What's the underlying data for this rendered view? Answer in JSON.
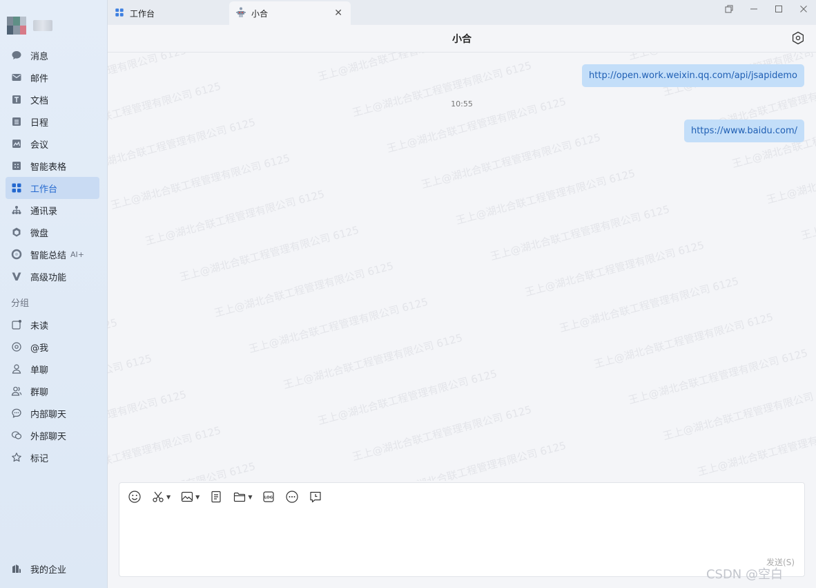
{
  "sidebar": {
    "items": [
      {
        "label": "消息",
        "icon": "message-icon"
      },
      {
        "label": "邮件",
        "icon": "mail-icon"
      },
      {
        "label": "文档",
        "icon": "doc-icon"
      },
      {
        "label": "日程",
        "icon": "calendar-icon"
      },
      {
        "label": "会议",
        "icon": "meeting-icon"
      },
      {
        "label": "智能表格",
        "icon": "smart-table-icon"
      },
      {
        "label": "工作台",
        "icon": "workbench-icon",
        "active": true
      },
      {
        "label": "通讯录",
        "icon": "contacts-icon"
      },
      {
        "label": "微盘",
        "icon": "drive-icon"
      },
      {
        "label": "智能总结",
        "icon": "summary-icon",
        "badge": "AI+"
      },
      {
        "label": "高级功能",
        "icon": "advanced-icon"
      }
    ],
    "group_label": "分组",
    "groups": [
      {
        "label": "未读",
        "icon": "unread-icon"
      },
      {
        "label": "@我",
        "icon": "at-icon"
      },
      {
        "label": "单聊",
        "icon": "single-chat-icon"
      },
      {
        "label": "群聊",
        "icon": "group-chat-icon"
      },
      {
        "label": "内部聊天",
        "icon": "internal-chat-icon"
      },
      {
        "label": "外部聊天",
        "icon": "external-chat-icon"
      },
      {
        "label": "标记",
        "icon": "star-icon"
      }
    ],
    "bottom": {
      "label": "我的企业",
      "icon": "enterprise-icon"
    }
  },
  "tabs": [
    {
      "label": "工作台",
      "icon": "workbench-icon"
    },
    {
      "label": "小合",
      "icon": "bot-icon",
      "active": true
    }
  ],
  "chat": {
    "title": "小合",
    "time": "10:55",
    "messages": [
      {
        "text": "http://open.work.weixin.qq.com/api/jsapidemo"
      },
      {
        "text": "https://www.baidu.com/"
      }
    ],
    "watermark": "王上@湖北合联工程管理有限公司 6125"
  },
  "input": {
    "send_label": "发送(S)",
    "footer_mark": "CSDN @空白"
  },
  "colors": {
    "accent": "#2468cf",
    "bubble": "#c3def9",
    "sidebar_bg": "#e0eaf6"
  }
}
